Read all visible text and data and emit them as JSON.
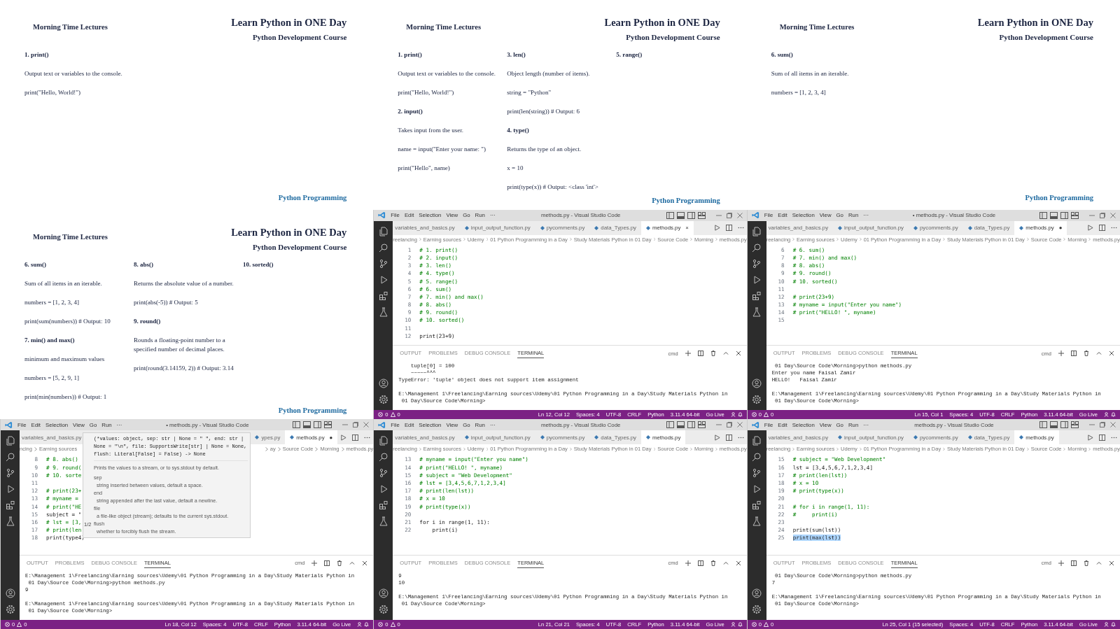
{
  "panels": [
    {
      "kind": "slide",
      "header": "Morning Time Lectures",
      "title": "Learn Python in ONE Day",
      "subtitle": "Python Development Course",
      "footer": "Python Programming",
      "columns": [
        [
          {
            "kind": "heading",
            "text": "1. print()"
          },
          {
            "kind": "text",
            "text": "Output text or variables to the console."
          },
          {
            "kind": "text",
            "text": "print(\"Hello, World!\")"
          }
        ]
      ]
    },
    {
      "kind": "slide",
      "header": "Morning Time Lectures",
      "title": "Learn Python in ONE Day",
      "subtitle": "Python Development Course",
      "footer": "Python Programming",
      "columns": [
        [
          {
            "kind": "heading",
            "text": "1. print()"
          },
          {
            "kind": "text",
            "text": "Output text or variables to the console."
          },
          {
            "kind": "text",
            "text": "print(\"Hello, World!\")"
          },
          {
            "kind": "heading",
            "text": "2. input()"
          },
          {
            "kind": "text",
            "text": "Takes input from the user."
          },
          {
            "kind": "text",
            "text": "name = input(\"Enter your name: \")"
          },
          {
            "kind": "text",
            "text": "print(\"Hello\", name)"
          }
        ],
        [
          {
            "kind": "heading",
            "text": "3. len()"
          },
          {
            "kind": "text",
            "text": "Object  length (number of items)."
          },
          {
            "kind": "text",
            "text": "string = \"Python\""
          },
          {
            "kind": "text",
            "text": "print(len(string))  # Output: 6"
          },
          {
            "kind": "heading",
            "text": "4. type()"
          },
          {
            "kind": "text",
            "text": "Returns the type of an object."
          },
          {
            "kind": "text",
            "text": "x = 10"
          },
          {
            "kind": "text",
            "text": "print(type(x))  # Output: <class 'int'>"
          }
        ],
        [
          {
            "kind": "heading",
            "text": "5. range()"
          }
        ]
      ]
    },
    {
      "kind": "slide",
      "header": "Morning Time Lectures",
      "title": "Learn Python in ONE Day",
      "subtitle": "Python Development Course",
      "footer": "Python Programming",
      "columns": [
        [
          {
            "kind": "heading",
            "text": "6. sum()"
          },
          {
            "kind": "text",
            "text": "Sum of all items in an iterable."
          },
          {
            "kind": "text",
            "text": "numbers = [1, 2, 3, 4]"
          }
        ]
      ]
    },
    {
      "kind": "slide",
      "header": "Morning Time Lectures",
      "title": "Learn Python in ONE Day",
      "subtitle": "Python Development Course",
      "footer": "Python Programming",
      "columns": [
        [
          {
            "kind": "heading",
            "text": "6. sum()"
          },
          {
            "kind": "text",
            "text": "Sum of all items in an iterable."
          },
          {
            "kind": "text",
            "text": "numbers = [1, 2, 3, 4]"
          },
          {
            "kind": "text",
            "text": "print(sum(numbers))  # Output: 10"
          },
          {
            "kind": "heading",
            "text": "7. min() and max()"
          },
          {
            "kind": "text",
            "text": "minimum and maximum values"
          },
          {
            "kind": "text",
            "text": "numbers = [5, 2, 9, 1]"
          },
          {
            "kind": "text",
            "text": "print(min(numbers))  # Output: 1"
          }
        ],
        [
          {
            "kind": "heading",
            "text": "8. abs()"
          },
          {
            "kind": "text",
            "text": "Returns the absolute value of a number."
          },
          {
            "kind": "text",
            "text": "print(abs(-5))  # Output: 5"
          },
          {
            "kind": "heading",
            "text": "9. round()"
          },
          {
            "kind": "text",
            "text": "Rounds a floating-point number to a specified number of decimal places."
          },
          {
            "kind": "text",
            "text": "print(round(3.14159, 2))  # Output: 3.14"
          }
        ],
        [
          {
            "kind": "heading",
            "text": "10. sorted()"
          }
        ]
      ]
    },
    {
      "kind": "vscode",
      "menu": [
        "File",
        "Edit",
        "Selection",
        "View",
        "Go",
        "Run",
        "···"
      ],
      "title": "methods.py - Visual Studio Code",
      "tabs": [
        {
          "label": "variables_and_basics.py",
          "selected": false
        },
        {
          "label": "input_output_function.py",
          "selected": false
        },
        {
          "label": "pycomments.py",
          "selected": false
        },
        {
          "label": "data_Types.py",
          "selected": false
        },
        {
          "label": "methods.py",
          "selected": true,
          "marker": "×"
        }
      ],
      "breadcrumb": [
        "reelancing",
        "Earning sources",
        "Udemy",
        "01 Python Programming in a Day",
        "Study Materials Python in 01 Day",
        "Source Code",
        "Morning",
        "methods.py"
      ],
      "lines": [
        {
          "n": "1",
          "code": "# 1. print()",
          "kind": "comment"
        },
        {
          "n": "2",
          "code": "# 2. input()",
          "kind": "comment"
        },
        {
          "n": "3",
          "code": "# 3. len()",
          "kind": "comment"
        },
        {
          "n": "4",
          "code": "# 4. type()",
          "kind": "comment"
        },
        {
          "n": "5",
          "code": "# 5. range()",
          "kind": "comment"
        },
        {
          "n": "6",
          "code": "# 6. sum()",
          "kind": "comment"
        },
        {
          "n": "7",
          "code": "# 7. min() and max()",
          "kind": "comment"
        },
        {
          "n": "8",
          "code": "# 8. abs()",
          "kind": "comment"
        },
        {
          "n": "9",
          "code": "# 9. round()",
          "kind": "comment"
        },
        {
          "n": "10",
          "code": "# 10. sorted()",
          "kind": "comment"
        },
        {
          "n": "11"
        },
        {
          "n": "12",
          "code": "print(23+9)",
          "kind": "code"
        }
      ],
      "panel_tabs": [
        {
          "label": "OUTPUT",
          "selected": false
        },
        {
          "label": "PROBLEMS",
          "selected": false
        },
        {
          "label": "DEBUG CONSOLE",
          "selected": false
        },
        {
          "label": "TERMINAL",
          "selected": true
        }
      ],
      "shell": "cmd",
      "terminal": [
        [
          "    tuple[0] = 100",
          "    ~~~~~^^^",
          "TypeError: 'tuple' object does not support item assignment"
        ],
        [
          "E:\\Management 1\\Freelancing\\Earning sources\\Udemy\\01 Python Programming in a Day\\Study Materials Python in",
          " 01 Day\\Source Code\\Morning>"
        ]
      ],
      "errors": "0",
      "warnings": "0",
      "status": [
        "Ln 12, Col 12",
        "Spaces: 4",
        "UTF-8",
        "CRLF",
        "Python",
        "3.11.4 64-bit",
        "Go Live"
      ]
    },
    {
      "kind": "vscode",
      "menu": [
        "File",
        "Edit",
        "Selection",
        "View",
        "Go",
        "Run",
        "···"
      ],
      "title": "• methods.py - Visual Studio Code",
      "tabs": [
        {
          "label": "variables_and_basics.py",
          "selected": false
        },
        {
          "label": "input_output_function.py",
          "selected": false
        },
        {
          "label": "pycomments.py",
          "selected": false
        },
        {
          "label": "data_Types.py",
          "selected": false
        },
        {
          "label": "methods.py",
          "selected": true,
          "marker": "●"
        }
      ],
      "breadcrumb": [
        "reelancing",
        "Earning sources",
        "Udemy",
        "01 Python Programming in a Day",
        "Study Materials Python in 01 Day",
        "Source Code",
        "Morning",
        "methods.py"
      ],
      "lines": [
        {
          "n": "6",
          "code": "# 6. sum()",
          "kind": "comment"
        },
        {
          "n": "7",
          "code": "# 7. min() and max()",
          "kind": "comment"
        },
        {
          "n": "8",
          "code": "# 8. abs()",
          "kind": "comment"
        },
        {
          "n": "9",
          "code": "# 9. round()",
          "kind": "comment"
        },
        {
          "n": "10",
          "code": "# 10. sorted()",
          "kind": "comment"
        },
        {
          "n": "11"
        },
        {
          "n": "12",
          "code": "# print(23+9)",
          "kind": "comment"
        },
        {
          "n": "13",
          "code": "# myname = input(\"Enter you name\")",
          "kind": "comment"
        },
        {
          "n": "14",
          "code": "# print(\"HELLO! \", myname)",
          "kind": "comment"
        },
        {
          "n": "15"
        }
      ],
      "panel_tabs": [
        {
          "label": "OUTPUT",
          "selected": false
        },
        {
          "label": "PROBLEMS",
          "selected": false
        },
        {
          "label": "DEBUG CONSOLE",
          "selected": false
        },
        {
          "label": "TERMINAL",
          "selected": true
        }
      ],
      "shell": "cmd",
      "terminal": [
        [
          " 01 Day\\Source Code\\Morning>python methods.py",
          "Enter you name Faisal Zamir",
          "HELLO!   Faisal Zamir"
        ],
        [
          "E:\\Management 1\\Freelancing\\Earning sources\\Udemy\\01 Python Programming in a Day\\Study Materials Python in",
          " 01 Day\\Source Code\\Morning>"
        ]
      ],
      "errors": "0",
      "warnings": "0",
      "status": [
        "Ln 15, Col 1",
        "Spaces: 4",
        "UTF-8",
        "CRLF",
        "Python",
        "3.11.4 64-bit",
        "Go Live"
      ]
    },
    {
      "kind": "vscode",
      "menu": [
        "File",
        "Edit",
        "Selection",
        "View",
        "Go",
        "Run",
        "···"
      ],
      "title": "• methods.py - Visual Studio Code",
      "tabs": [
        {
          "label": "variables_and_basics.py",
          "selected": false
        },
        {
          "label": "ypes.py",
          "selected": false
        },
        {
          "label": "methods.py",
          "selected": true,
          "marker": "●"
        }
      ],
      "breadcrumb": [
        "ncing",
        "Earning sources",
        "ay",
        "Source Code",
        "Morning",
        "methods.py"
      ],
      "lines": [
        {
          "n": "8",
          "code": "# 8. abs()",
          "kind": "comment"
        },
        {
          "n": "9",
          "code": "# 9. round(",
          "kind": "comment"
        },
        {
          "n": "10",
          "code": "# 10. sorte",
          "kind": "comment"
        },
        {
          "n": "11"
        },
        {
          "n": "12",
          "code": "# print(23+",
          "kind": "comment"
        },
        {
          "n": "13",
          "code": "# myname =",
          "kind": "comment"
        },
        {
          "n": "14",
          "code": "# print(\"HE",
          "kind": "comment"
        },
        {
          "n": "15",
          "code": "subject = \"",
          "kind": "code"
        },
        {
          "n": "16",
          "code": "# lst = [3,",
          "kind": "comment"
        },
        {
          "n": "17",
          "code": "# print(len",
          "kind": "comment"
        },
        {
          "n": "18",
          "code": "print(type4)",
          "kind": "code"
        }
      ],
      "popup": {
        "signature": [
          "(*values: object, sep: str | None = \" \", end: str |",
          "None = \"\\n\", file: SupportsWrite[str] | None = None,",
          "flush: Literal[False] = False) -> None"
        ],
        "description": "Prints the values to a stream, or to sys.stdout by default.",
        "params": [
          {
            "name": "sep",
            "text": "string inserted between values, default a space."
          },
          {
            "name": "end",
            "text": "string appended after the last value, default a newline."
          },
          {
            "name": "file",
            "text": "a file-like object (stream); defaults to the current sys.stdout."
          },
          {
            "name": "flush",
            "text": "whether to forcibly flush the stream."
          }
        ],
        "counter": "1/2"
      },
      "panel_tabs": [
        {
          "label": "OUTPUT",
          "selected": false
        },
        {
          "label": "PROBLEMS",
          "selected": false
        },
        {
          "label": "DEBUG CONSOLE",
          "selected": false
        },
        {
          "label": "TERMINAL",
          "selected": true
        }
      ],
      "shell": "cmd",
      "terminal": [
        [
          "E:\\Management 1\\Freelancing\\Earning sources\\Udemy\\01 Python Programming in a Day\\Study Materials Python in",
          " 01 Day\\Source Code\\Morning>python methods.py",
          "9"
        ],
        [
          "E:\\Management 1\\Freelancing\\Earning sources\\Udemy\\01 Python Programming in a Day\\Study Materials Python in",
          " 01 Day\\Source Code\\Morning>"
        ]
      ],
      "errors": "0",
      "warnings": "0",
      "status": [
        "Ln 18, Col 12",
        "Spaces: 4",
        "UTF-8",
        "CRLF",
        "Python",
        "3.11.4 64-bit",
        "Go Live"
      ]
    },
    {
      "kind": "vscode",
      "menu": [
        "File",
        "Edit",
        "Selection",
        "View",
        "Go",
        "Run",
        "···"
      ],
      "title": "methods.py - Visual Studio Code",
      "tabs": [
        {
          "label": "variables_and_basics.py",
          "selected": false
        },
        {
          "label": "input_output_function.py",
          "selected": false
        },
        {
          "label": "pycomments.py",
          "selected": false
        },
        {
          "label": "data_Types.py",
          "selected": false
        },
        {
          "label": "methods.py",
          "selected": true
        }
      ],
      "breadcrumb": [
        "reelancing",
        "Earning sources",
        "Udemy",
        "01 Python Programming in a Day",
        "Study Materials Python in 01 Day",
        "Source Code",
        "Morning",
        "methods.py"
      ],
      "lines": [
        {
          "n": "13",
          "code": "# myname = input(\"Enter you name\")",
          "kind": "comment"
        },
        {
          "n": "14",
          "code": "# print(\"HELLO! \", myname)",
          "kind": "comment"
        },
        {
          "n": "15",
          "code": "# subject = \"Web Development\"",
          "kind": "comment"
        },
        {
          "n": "16",
          "code": "# lst = [3,4,5,6,7,1,2,3,4]",
          "kind": "comment"
        },
        {
          "n": "17",
          "code": "# print(len(lst))",
          "kind": "comment"
        },
        {
          "n": "18",
          "code": "# x = 10",
          "kind": "comment"
        },
        {
          "n": "19",
          "code": "# print(type(x))",
          "kind": "comment"
        },
        {
          "n": "20"
        },
        {
          "n": "21",
          "code": "for i in range(1, 11):",
          "kind": "code"
        },
        {
          "n": "22",
          "code": "    print(i)",
          "kind": "code"
        }
      ],
      "panel_tabs": [
        {
          "label": "OUTPUT",
          "selected": false
        },
        {
          "label": "PROBLEMS",
          "selected": false
        },
        {
          "label": "DEBUG CONSOLE",
          "selected": false
        },
        {
          "label": "TERMINAL",
          "selected": true
        }
      ],
      "shell": "cmd",
      "terminal": [
        [
          "9",
          "10"
        ],
        [
          "E:\\Management 1\\Freelancing\\Earning sources\\Udemy\\01 Python Programming in a Day\\Study Materials Python in",
          " 01 Day\\Source Code\\Morning>"
        ]
      ],
      "errors": "0",
      "warnings": "0",
      "status": [
        "Ln 21, Col 21",
        "Spaces: 4",
        "UTF-8",
        "CRLF",
        "Python",
        "3.11.4 64-bit",
        "Go Live"
      ]
    },
    {
      "kind": "vscode",
      "menu": [
        "File",
        "Edit",
        "Selection",
        "View",
        "Go",
        "Run",
        "···"
      ],
      "title": "methods.py - Visual Studio Code",
      "tabs": [
        {
          "label": "variables_and_basics.py",
          "selected": false
        },
        {
          "label": "input_output_function.py",
          "selected": false
        },
        {
          "label": "pycomments.py",
          "selected": false
        },
        {
          "label": "data_Types.py",
          "selected": false
        },
        {
          "label": "methods.py",
          "selected": true
        }
      ],
      "breadcrumb": [
        "reelancing",
        "Earning sources",
        "Udemy",
        "01 Python Programming in a Day",
        "Study Materials Python in 01 Day",
        "Source Code",
        "Morning",
        "methods.py"
      ],
      "lines": [
        {
          "n": "15",
          "code": "# subject = \"Web Development\"",
          "kind": "comment"
        },
        {
          "n": "16",
          "code": "lst = [3,4,5,6,7,1,2,3,4]",
          "kind": "code"
        },
        {
          "n": "17",
          "code": "# print(len(lst))",
          "kind": "comment"
        },
        {
          "n": "18",
          "code": "# x = 10",
          "kind": "comment"
        },
        {
          "n": "19",
          "code": "# print(type(x))",
          "kind": "comment"
        },
        {
          "n": "20"
        },
        {
          "n": "21",
          "code": "# for i in range(1, 11):",
          "kind": "comment"
        },
        {
          "n": "22",
          "code": "#     print(i)",
          "kind": "comment"
        },
        {
          "n": "23"
        },
        {
          "n": "24",
          "code": "print(sum(lst))",
          "kind": "code"
        },
        {
          "n": "25",
          "code": "print(max(lst))",
          "kind": "selected"
        }
      ],
      "panel_tabs": [
        {
          "label": "OUTPUT",
          "selected": false
        },
        {
          "label": "PROBLEMS",
          "selected": false
        },
        {
          "label": "DEBUG CONSOLE",
          "selected": false
        },
        {
          "label": "TERMINAL",
          "selected": true
        }
      ],
      "shell": "cmd",
      "terminal": [
        [
          " 01 Day\\Source Code\\Morning>python methods.py",
          "7"
        ],
        [
          "E:\\Management 1\\Freelancing\\Earning sources\\Udemy\\01 Python Programming in a Day\\Study Materials Python in",
          " 01 Day\\Source Code\\Morning>"
        ]
      ],
      "errors": "0",
      "warnings": "0",
      "status": [
        "Ln 25, Col 1 (15 selected)",
        "Spaces: 4",
        "UTF-8",
        "CRLF",
        "Python",
        "3.11.4 64-bit",
        "Go Live"
      ]
    }
  ]
}
